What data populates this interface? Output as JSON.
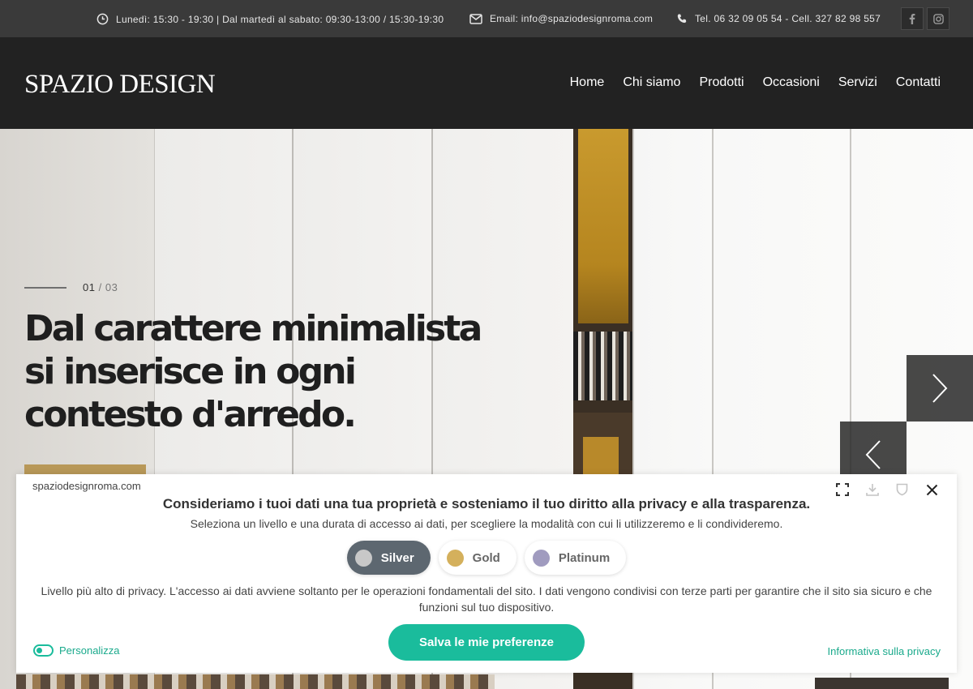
{
  "topbar": {
    "hours": "Lunedì: 15:30 - 19:30 | Dal martedì al sabato: 09:30-13:00 / 15:30-19:30",
    "email": "Email: info@spaziodesignroma.com",
    "phone": "Tel. 06 32 09 05 54 - Cell. 327 82 98 557",
    "social": [
      "facebook-icon",
      "instagram-icon"
    ]
  },
  "header": {
    "logo": "SPAZIO DESIGN",
    "nav": [
      "Home",
      "Chi siamo",
      "Prodotti",
      "Occasioni",
      "Servizi",
      "Contatti"
    ]
  },
  "hero": {
    "current": "01",
    "separator": "/",
    "total": "03",
    "title": "Dal carattere minimalista si inserisce in ogni contesto d'arredo."
  },
  "cookie": {
    "site": "spaziodesignroma.com",
    "title": "Consideriamo i tuoi dati una tua proprietà e sosteniamo il tuo diritto alla privacy e alla trasparenza.",
    "subtitle": "Seleziona un livello e una durata di accesso ai dati, per scegliere la modalità con cui li utilizzeremo e li condivideremo.",
    "levels": [
      {
        "label": "Silver",
        "color": "#c8c8c8",
        "selected": true
      },
      {
        "label": "Gold",
        "color": "#d4b05c",
        "selected": false
      },
      {
        "label": "Platinum",
        "color": "#a09bbf",
        "selected": false
      }
    ],
    "description": "Livello più alto di privacy. L'accesso ai dati avviene soltanto per le operazioni fondamentali del sito. I dati vengono condivisi con terze parti per garantire che il sito sia sicuro e che funzioni sul tuo dispositivo.",
    "save_label": "Salva le mie preferenze",
    "customize_label": "Personalizza",
    "policy_label": "Informativa sulla privacy"
  },
  "colors": {
    "accent": "#1abc9c",
    "header_bg": "#222222",
    "topbar_bg": "#3a3a3a",
    "hero_button": "#b89858"
  }
}
